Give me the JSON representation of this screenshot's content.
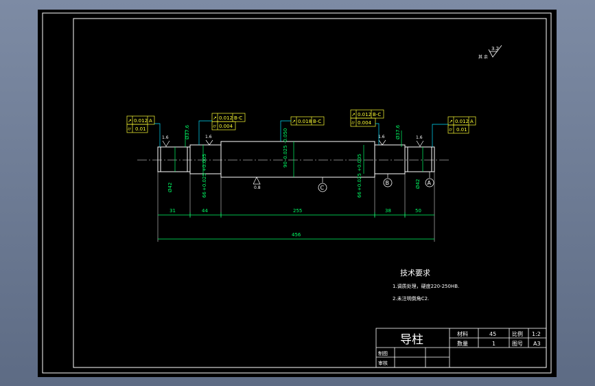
{
  "colors": {
    "background": "#000000",
    "border": "#ffffff",
    "outline": "#ffffff",
    "dimension": "#00ff66",
    "leader": "#00e0ff",
    "frame_text": "#ffff33"
  },
  "roughness_general": {
    "label": "其 余",
    "value": "3.2"
  },
  "dimensions": {
    "d31": "31",
    "d44": "44",
    "d255": "255",
    "d38": "38",
    "d50": "50",
    "d456": "456",
    "phi42_left": "Ø42",
    "phi42_right": "Ø42",
    "phi376_left": "Ø37.6",
    "phi376_right": "Ø37.6",
    "d66_left": "66",
    "d66_right": "66",
    "tol_66": "+0.025 +0.005",
    "d90": "90",
    "tol_90": "-0.025 -0.050",
    "rough_08": "0.8",
    "rough_16_a": "1.6",
    "rough_16_b": "1.6",
    "rough_16_c": "1.6",
    "rough_16_d": "1.6"
  },
  "datums": {
    "a": "A",
    "b": "B",
    "c": "C"
  },
  "fcf": {
    "left_outer": {
      "row1_symbol": "↗",
      "row1_value": "0.012",
      "row1_ref": "A",
      "row2_symbol": "⌭",
      "row2_value": "0.01"
    },
    "left_inner": {
      "row1_symbol": "↗",
      "row1_value": "0.012",
      "row1_ref": "B-C",
      "row2_symbol": "⌭",
      "row2_value": "0.004"
    },
    "center": {
      "row1_symbol": "↗",
      "row1_value": "0.018",
      "row1_ref": "B-C"
    },
    "right_inner": {
      "row1_symbol": "↗",
      "row1_value": "0.012",
      "row1_ref": "B-C",
      "row2_symbol": "⌭",
      "row2_value": "0.004"
    },
    "right_outer": {
      "row1_symbol": "↗",
      "row1_value": "0.012",
      "row1_ref": "A",
      "row2_symbol": "⌭",
      "row2_value": "0.01"
    }
  },
  "tech_req": {
    "title": "技术要求",
    "line1": "1.调质处理，硬度220-250HB.",
    "line2": "2.未注明倒角C2."
  },
  "title_block": {
    "part_name": "导柱",
    "material_label": "材料",
    "material_value": "45",
    "scale_label": "比例",
    "scale_value": "1:2",
    "qty_label": "数量",
    "qty_value": "1",
    "drawing_no_label": "图号",
    "drawing_no_value": "A3",
    "drawn_by_label": "制图",
    "checked_by_label": "审核"
  }
}
